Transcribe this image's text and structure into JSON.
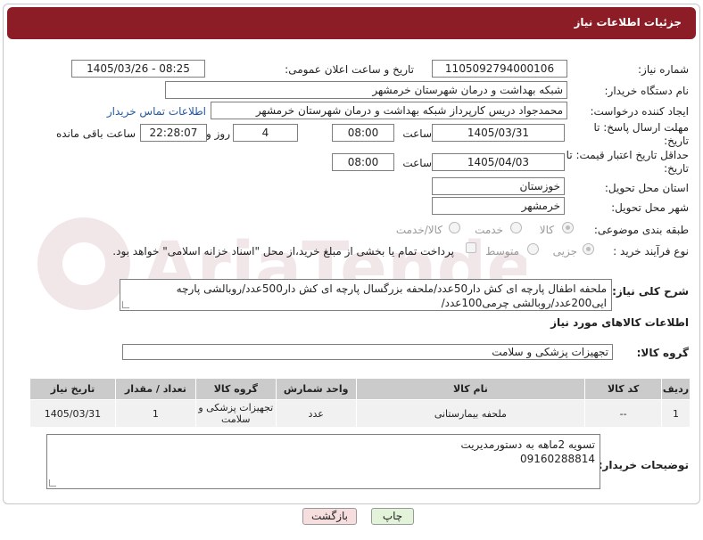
{
  "header": {
    "title": "جزئیات اطلاعات نیاز"
  },
  "fields": {
    "need_number_label": "شماره نیاز:",
    "need_number": "1105092794000106",
    "announce_label": "تاریخ و ساعت اعلان عمومی:",
    "announce_value": "1405/03/26 - 08:25",
    "buyer_org_label": "نام دستگاه خریدار:",
    "buyer_org": "شبکه بهداشت و درمان شهرستان خرمشهر",
    "creator_label": "ایجاد کننده درخواست:",
    "creator": "محمدجواد دریس کارپرداز شبکه بهداشت و درمان شهرستان خرمشهر",
    "contact_link": "اطلاعات تماس خریدار",
    "reply_deadline_label": "مهلت ارسال پاسخ: تا تاریخ:",
    "reply_date": "1405/03/31",
    "time_label": "ساعت",
    "reply_time": "08:00",
    "days": "4",
    "days_label": "روز و",
    "remaining_time": "22:28:07",
    "remaining_label": "ساعت باقی مانده",
    "price_deadline_label": "حداقل تاریخ اعتبار قیمت: تا تاریخ:",
    "price_date": "1405/04/03",
    "price_time": "08:00",
    "province_label": "استان محل تحویل:",
    "province": "خوزستان",
    "city_label": "شهر محل تحویل:",
    "city": "خرمشهر",
    "category_label": "طبقه بندی موضوعی:",
    "category_options": [
      "کالا",
      "خدمت",
      "کالا/خدمت"
    ],
    "process_label": "نوع فرآیند خرید :",
    "process_options": [
      "جزیی",
      "متوسط"
    ],
    "payment_note": "پرداخت تمام یا بخشی از مبلغ خرید،از محل \"اسناد خزانه اسلامی\" خواهد بود."
  },
  "description": {
    "label": "شرح کلی نیاز:",
    "text": "ملحفه اطفال پارچه ای کش دار50عدد/ملحفه بزرگسال پارچه ای کش دار500عدد/روبالشی پارچه ایی200عدد/روبالشی چرمی100عدد/"
  },
  "goods_section": {
    "title": "اطلاعات کالاهای مورد نیاز",
    "group_label": "گروه کالا:",
    "group_value": "تجهیزات پزشکی و سلامت"
  },
  "table": {
    "headers": [
      "ردیف",
      "کد کالا",
      "نام کالا",
      "واحد شمارش",
      "گروه کالا",
      "تعداد / مقدار",
      "تاریخ نیاز"
    ],
    "rows": [
      [
        "1",
        "--",
        "ملحفه بیمارستانی",
        "عدد",
        "تجهیزات پزشکی و سلامت",
        "1",
        "1405/03/31"
      ]
    ]
  },
  "buyer_notes": {
    "label": "توضیحات خریدار:",
    "line1": "تسویه 2ماهه به دستورمدیریت",
    "line2": "09160288814"
  },
  "buttons": {
    "print": "چاپ",
    "back": "بازگشت"
  },
  "watermark": {
    "text": "AriaTender.net"
  },
  "colors": {
    "header": "#8c1c26",
    "print_button": "#e3f3d9",
    "back_button": "#f7dede",
    "link": "#2358a4"
  }
}
